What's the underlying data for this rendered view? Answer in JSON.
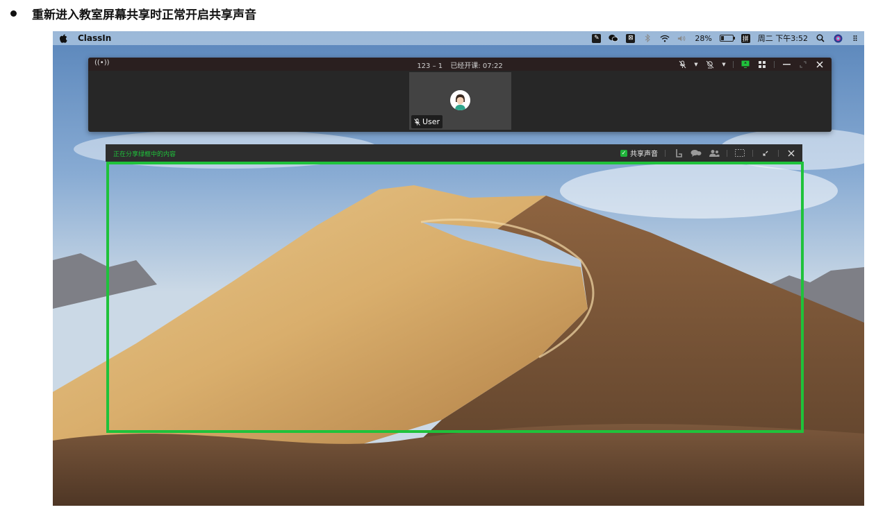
{
  "caption": {
    "text": "重新进入教室屏幕共享时正常开启共享声音"
  },
  "menubar": {
    "app_name": "ClassIn",
    "battery_percent": "28%",
    "battery_level": 0.28,
    "clock": "周二 下午3:52",
    "input_method": "拼",
    "icons": [
      "apple-icon",
      "screenshot-app-icon",
      "wechat-icon",
      "app-icon",
      "bluetooth-icon",
      "wifi-icon",
      "volume-icon",
      "battery-icon",
      "input-method-icon",
      "search-icon",
      "siri-icon",
      "menu-extras-icon"
    ]
  },
  "classroom": {
    "room": "123 – 1",
    "elapsed_label": "已经开课: 07:22",
    "tile_user": "User",
    "tools": [
      "mic-mute-icon",
      "camera-mute-icon",
      "screen-share-icon",
      "grid-layout-icon",
      "minimize-icon",
      "fullscreen-icon",
      "close-icon"
    ]
  },
  "sharebar": {
    "status_text": "正在分享绿框中的内容",
    "share_audio_label": "共享声音",
    "share_audio_checked": true,
    "tools": [
      "raise-hand-icon",
      "chat-icon",
      "members-icon",
      "select-area-icon",
      "collapse-icon",
      "close-icon"
    ]
  },
  "colors": {
    "accent_green": "#1fc23b",
    "window_bg": "#272727",
    "titlebar_bg": "#2a1f1f"
  }
}
